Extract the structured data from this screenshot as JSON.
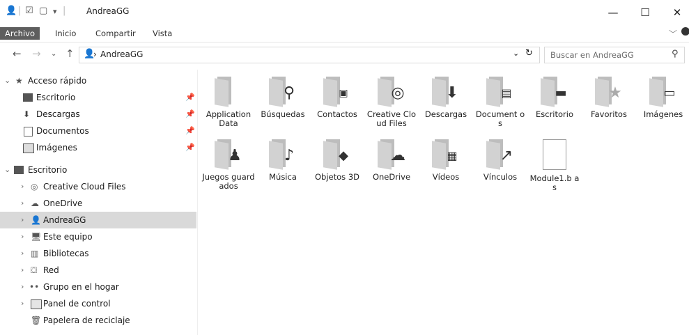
{
  "window": {
    "title": "AndreaGG",
    "controls": {
      "minimize": "—",
      "maximize": "☐",
      "close": "✕"
    }
  },
  "ribbon": {
    "tabs": [
      "Archivo",
      "Inicio",
      "Compartir",
      "Vista"
    ],
    "active": "Archivo"
  },
  "address": {
    "path": "AndreaGG",
    "separator": "›"
  },
  "search": {
    "placeholder": "Buscar en AndreaGG"
  },
  "navpane": {
    "quick_access": "Acceso rápido",
    "quick_items": [
      "Escritorio",
      "Descargas",
      "Documentos",
      "Imágenes"
    ],
    "desktop": "Escritorio",
    "desktop_items": [
      "Creative Cloud Files",
      "OneDrive",
      "AndreaGG",
      "Este equipo",
      "Bibliotecas",
      "Red",
      "Grupo en el hogar",
      "Panel de control",
      "Papelera de reciclaje"
    ],
    "selected": "AndreaGG"
  },
  "content": {
    "items": [
      {
        "label": "Application Data",
        "icon": "app-data-icon"
      },
      {
        "label": "Búsquedas",
        "icon": "search-icon"
      },
      {
        "label": "Contactos",
        "icon": "contacts-icon"
      },
      {
        "label": "Creative Cloud Files",
        "icon": "creative-cloud-icon"
      },
      {
        "label": "Descargas",
        "icon": "download-icon"
      },
      {
        "label": "Document os",
        "icon": "document-icon"
      },
      {
        "label": "Escritorio",
        "icon": "desktop-icon"
      },
      {
        "label": "Favoritos",
        "icon": "star-icon"
      },
      {
        "label": "Imágenes",
        "icon": "image-icon"
      },
      {
        "label": "Juegos guardados",
        "icon": "games-icon"
      },
      {
        "label": "Música",
        "icon": "music-icon"
      },
      {
        "label": "Objetos 3D",
        "icon": "cube-icon"
      },
      {
        "label": "OneDrive",
        "icon": "cloud-icon"
      },
      {
        "label": "Vídeos",
        "icon": "video-icon"
      },
      {
        "label": "Vínculos",
        "icon": "link-arrow-icon"
      },
      {
        "label": "Module1.b as",
        "icon": "file-icon"
      }
    ]
  }
}
